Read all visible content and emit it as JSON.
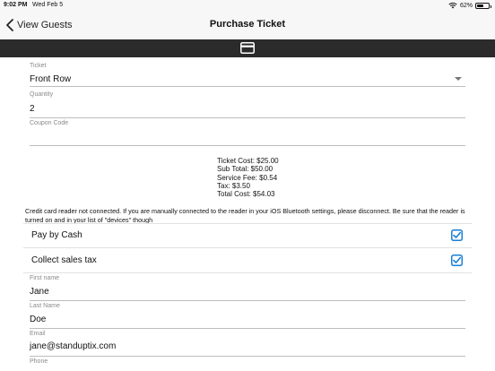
{
  "status_bar": {
    "time": "9:02 PM",
    "date": "Wed Feb 5",
    "battery_text": "62%",
    "battery_level": 0.62,
    "wifi_icon": "wifi-icon"
  },
  "nav": {
    "back_label": "View Guests",
    "title": "Purchase Ticket"
  },
  "card_strip": {
    "icon": "credit-card-icon"
  },
  "form": {
    "ticket": {
      "label": "Ticket",
      "value": "Front Row"
    },
    "quantity": {
      "label": "Quantity",
      "value": "2"
    },
    "coupon": {
      "label": "Coupon Code",
      "value": ""
    }
  },
  "summary": {
    "ticket_cost": "Ticket Cost: $25.00",
    "sub_total": "Sub Total: $50.00",
    "service_fee": "Service Fee: $0.54",
    "tax": "Tax: $3.50",
    "total_cost": "Total Cost: $54.03"
  },
  "warning": "Credit card reader not connected. If you are manually connected to the reader in your iOS Bluetooth settings, please disconnect. Be sure that the reader is turned on and in your list of \"devices\" though",
  "toggles": {
    "pay_by_cash": {
      "label": "Pay by Cash",
      "checked": true
    },
    "collect_sales_tax": {
      "label": "Collect sales tax",
      "checked": true
    }
  },
  "guest": {
    "first_name": {
      "label": "First name",
      "value": "Jane"
    },
    "last_name": {
      "label": "Last Name",
      "value": "Doe"
    },
    "email": {
      "label": "Email",
      "value": "jane@standuptix.com"
    },
    "phone": {
      "label": "Phone",
      "value": ""
    }
  },
  "colors": {
    "accent": "#1a7fd4",
    "strip": "#2b2b2b",
    "nav_bg": "#f7f7f7"
  }
}
